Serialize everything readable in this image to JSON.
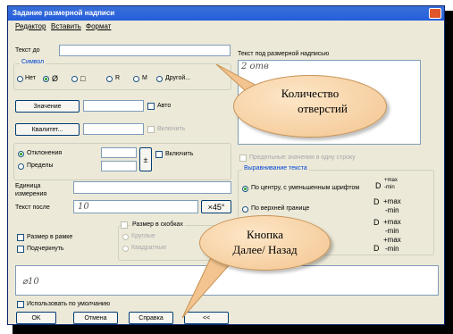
{
  "window": {
    "title": "Задание размерной надписи"
  },
  "menu": [
    "Редактор",
    "Вставить",
    "Формат"
  ],
  "text_before": {
    "label": "Текст до",
    "value": ""
  },
  "symbol": {
    "group_label": "Символ",
    "options": [
      "Нет",
      "Ø",
      "□",
      "R",
      "M",
      "Другой..."
    ],
    "selected": "Ø"
  },
  "value_row": {
    "button": "Значение",
    "auto_label": "Авто"
  },
  "qualitet_row": {
    "button": "Квалитет...",
    "enable_label": "Включить"
  },
  "deviations": {
    "option1": "Отклонения",
    "option2": "Пределы",
    "pm_sign": "±",
    "enable_label": "Включить"
  },
  "unit": {
    "label": "Единица измерения",
    "value": ""
  },
  "text_after": {
    "label": "Текст после",
    "value": "10",
    "multiplier": "×45°"
  },
  "checks": {
    "size_in_frame": "Размер в рамке",
    "underline": "Подчеркнуть"
  },
  "brackets": {
    "label": "Размер в скобках",
    "round": "Круглые",
    "square": "Квадратные"
  },
  "text_under": {
    "label": "Текст под размерной надписью",
    "value": "2 отв"
  },
  "limits_one_line": "Предельные значения в одну строку",
  "alignment": {
    "group_label": "Выравнивание текста",
    "center": "По центру, с уменьшенным шрифтом",
    "top": "По верхней границе",
    "sample_d": "D",
    "sample_max": "+max",
    "sample_min": "-min"
  },
  "preview_text": "⌀10",
  "use_default": "Использовать по умолчанию",
  "buttons": {
    "ok": "OK",
    "cancel": "Отмена",
    "help": "Справка",
    "back": "<<"
  },
  "callouts": {
    "holes": [
      "Количество",
      "отверстий"
    ],
    "nav": [
      "Кнопка",
      "Далее/ Назад"
    ]
  }
}
